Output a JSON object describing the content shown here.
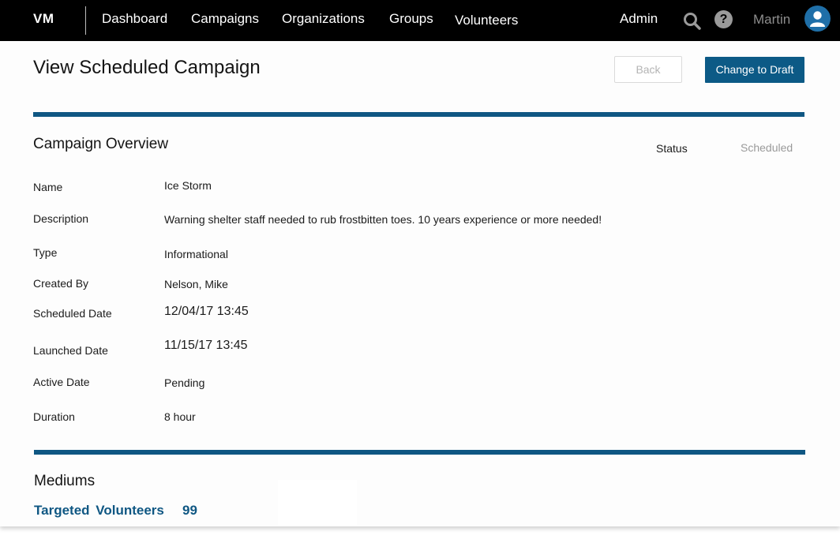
{
  "nav": {
    "brand": "VM",
    "links": [
      "Dashboard",
      "Campaigns",
      "Organizations",
      "Groups",
      "Volunteers"
    ],
    "admin": "Admin",
    "help_glyph": "?",
    "user_name": "Martin",
    "icons": {
      "search": "search-icon",
      "help": "help-icon",
      "avatar": "user-avatar-icon"
    }
  },
  "page": {
    "title": "View Scheduled Campaign",
    "back_label": "Back",
    "draft_label": "Change to Draft"
  },
  "overview": {
    "title": "Campaign Overview",
    "status_label": "Status",
    "status_value": "Scheduled",
    "fields": [
      {
        "label": "Name",
        "value": "Ice Storm"
      },
      {
        "label": "Description",
        "value": "Warning shelter staff needed to rub frostbitten toes. 10 years experience or more needed!"
      },
      {
        "label": "Type",
        "value": "Informational"
      },
      {
        "label": "Created By",
        "value": "Nelson, Mike"
      },
      {
        "label": "Scheduled Date",
        "value": "12/04/17 13:45"
      },
      {
        "label": "Launched Date",
        "value": "11/15/17 13:45"
      },
      {
        "label": "Active Date",
        "value": "Pending"
      },
      {
        "label": "Duration",
        "value": "8 hour"
      }
    ]
  },
  "mediums": {
    "title": "Mediums",
    "targeted_label": "Targeted Volunteers",
    "targeted_count": "99"
  },
  "colors": {
    "nav_bg": "#000000",
    "accent": "#0f5783",
    "button_primary": "#0c5a86",
    "avatar": "#1f6fa8"
  }
}
